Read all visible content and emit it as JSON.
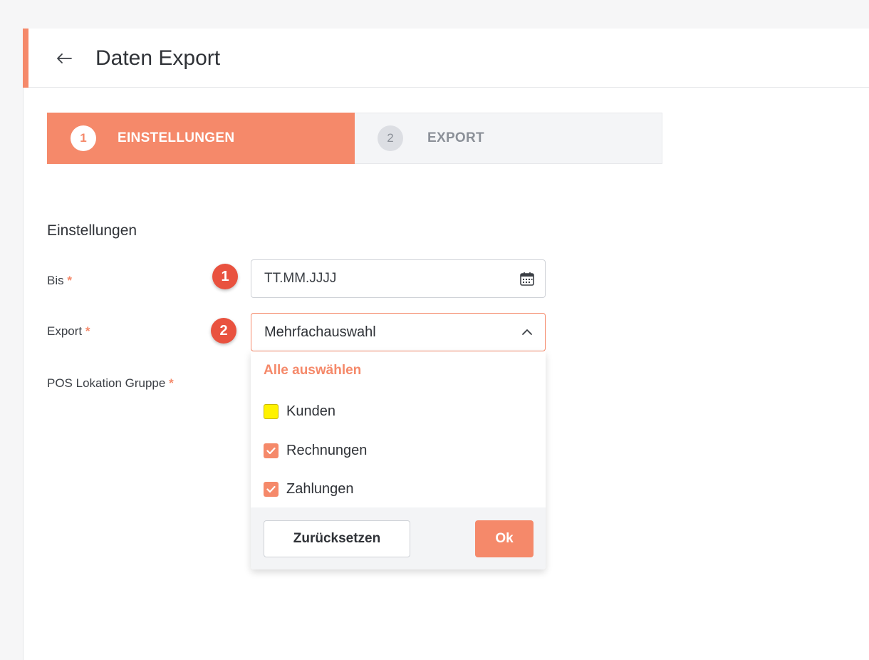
{
  "header": {
    "back_icon": "arrow-left-icon",
    "title": "Daten Export"
  },
  "stepper": {
    "steps": [
      {
        "number": "1",
        "label": "EINSTELLUNGEN",
        "active": true
      },
      {
        "number": "2",
        "label": "EXPORT",
        "active": false
      }
    ]
  },
  "form": {
    "section_title": "Einstellungen",
    "required_mark": "*",
    "fields": {
      "bis": {
        "label": "Bis",
        "placeholder": "TT.MM.JJJJ",
        "icon": "calendar-icon"
      },
      "export": {
        "label": "Export",
        "value": "Mehrfachauswahl",
        "icon": "chevron-up-icon"
      },
      "pos_location_group": {
        "label": "POS Lokation Gruppe"
      }
    },
    "markers": [
      "1",
      "2"
    ]
  },
  "dropdown": {
    "select_all": "Alle auswählen",
    "options": [
      {
        "label": "Kunden",
        "checked": false
      },
      {
        "label": "Rechnungen",
        "checked": true
      },
      {
        "label": "Zahlungen",
        "checked": true
      }
    ],
    "reset_label": "Zurücksetzen",
    "ok_label": "Ok"
  },
  "colors": {
    "accent": "#f5896a",
    "marker": "#e9523f",
    "highlight": "#fff200"
  }
}
